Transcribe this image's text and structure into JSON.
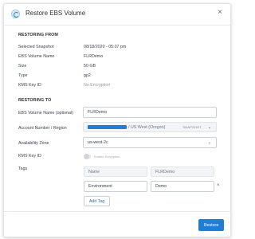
{
  "dialog": {
    "title": "Restore EBS Volume",
    "close_glyph": "×",
    "header_icon": "restore-icon"
  },
  "restoring_from": {
    "heading": "RESTORING FROM",
    "rows": [
      {
        "label": "Selected Snapshot",
        "value": "08/18/2020 - 05:07 pm"
      },
      {
        "label": "EBS Volume Name",
        "value": "FLRDemo"
      },
      {
        "label": "Size",
        "value": "50 GB"
      },
      {
        "label": "Type",
        "value": "gp2"
      },
      {
        "label": "KMS Key ID",
        "value": "No Encryption"
      }
    ]
  },
  "restoring_to": {
    "heading": "RESTORING TO",
    "volume_name": {
      "label": "EBS Volume Name (optional)",
      "value": "FLRDemo"
    },
    "account_region": {
      "label": "Account Number / Region",
      "value": "/ US West (Oregon)",
      "tag": "SNAPSHOT",
      "chevron": "⌄"
    },
    "availability_zone": {
      "label": "Availability Zone",
      "value": "us-west-2c",
      "chevron": "⌄"
    },
    "kms": {
      "label": "KMS Key ID",
      "toggle_label": "Enable Encryption",
      "enabled": false
    },
    "tags": {
      "label": "Tags",
      "header": {
        "key": "Name",
        "value": "FLRDemo"
      },
      "row": {
        "key": "Environment",
        "value": "Demo"
      },
      "remove_glyph": "×",
      "add_label": "Add Tag"
    }
  },
  "footer": {
    "restore_label": "Restore"
  },
  "colors": {
    "accent": "#1f7fd6"
  }
}
